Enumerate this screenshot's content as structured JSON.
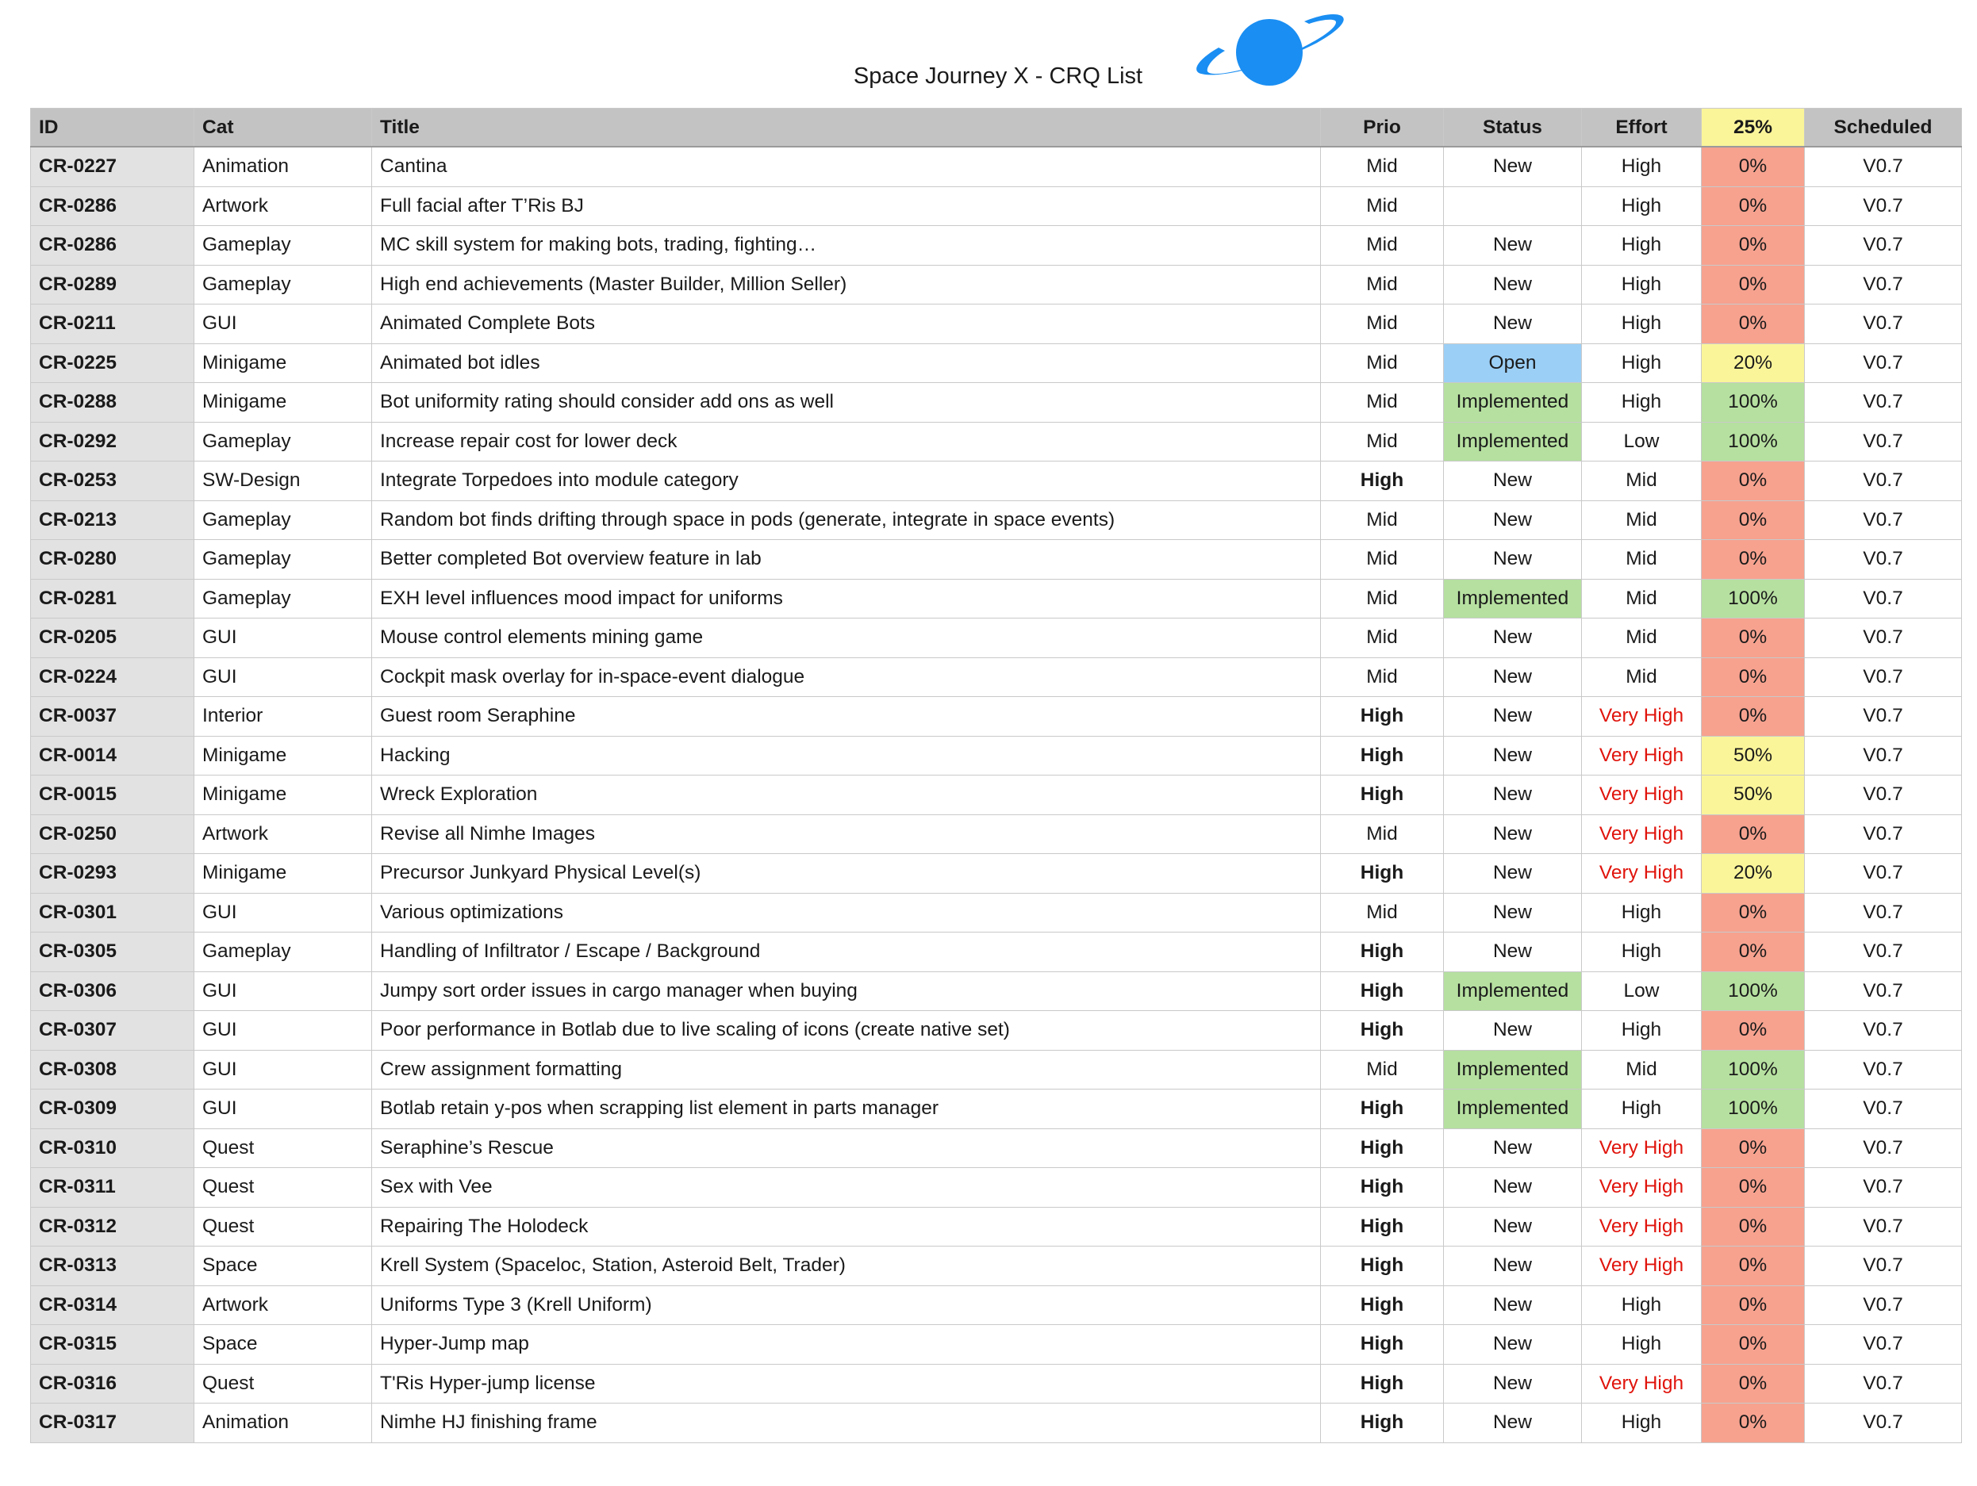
{
  "title": "Space Journey X - CRQ List",
  "logo_icon": "planet-icon",
  "colors": {
    "header_bg": "#c3c3c3",
    "id_col_bg": "#e2e2e2",
    "status_open": "#9ccff5",
    "status_implemented": "#b6e0a0",
    "pct_low": "#f6a28f",
    "pct_mid": "#fbf59a",
    "pct_done": "#b6e0a0",
    "very_high_text": "#e0140c",
    "planet": "#1a8ef2"
  },
  "columns": [
    "ID",
    "Cat",
    "Title",
    "Prio",
    "Status",
    "Effort",
    "25%",
    "Scheduled"
  ],
  "rows": [
    {
      "id": "CR-0227",
      "cat": "Animation",
      "title": "Cantina",
      "prio": "Mid",
      "status": "New",
      "effort": "High",
      "pct": "0%",
      "scheduled": "V0.7"
    },
    {
      "id": "CR-0286",
      "cat": "Artwork",
      "title": "Full facial after T’Ris BJ",
      "prio": "Mid",
      "status": "",
      "effort": "High",
      "pct": "0%",
      "scheduled": "V0.7"
    },
    {
      "id": "CR-0286",
      "cat": "Gameplay",
      "title": "MC skill system for making bots, trading, fighting…",
      "prio": "Mid",
      "status": "New",
      "effort": "High",
      "pct": "0%",
      "scheduled": "V0.7"
    },
    {
      "id": "CR-0289",
      "cat": "Gameplay",
      "title": "High end achievements (Master Builder, Million Seller)",
      "prio": "Mid",
      "status": "New",
      "effort": "High",
      "pct": "0%",
      "scheduled": "V0.7"
    },
    {
      "id": "CR-0211",
      "cat": "GUI",
      "title": "Animated Complete Bots",
      "prio": "Mid",
      "status": "New",
      "effort": "High",
      "pct": "0%",
      "scheduled": "V0.7"
    },
    {
      "id": "CR-0225",
      "cat": "Minigame",
      "title": "Animated bot idles",
      "prio": "Mid",
      "status": "Open",
      "effort": "High",
      "pct": "20%",
      "scheduled": "V0.7"
    },
    {
      "id": "CR-0288",
      "cat": "Minigame",
      "title": "Bot uniformity rating should consider add ons as well",
      "prio": "Mid",
      "status": "Implemented",
      "effort": "High",
      "pct": "100%",
      "scheduled": "V0.7"
    },
    {
      "id": "CR-0292",
      "cat": "Gameplay",
      "title": "Increase repair cost for lower deck",
      "prio": "Mid",
      "status": "Implemented",
      "effort": "Low",
      "pct": "100%",
      "scheduled": "V0.7"
    },
    {
      "id": "CR-0253",
      "cat": "SW-Design",
      "title": "Integrate Torpedoes into module category",
      "prio": "High",
      "status": "New",
      "effort": "Mid",
      "pct": "0%",
      "scheduled": "V0.7"
    },
    {
      "id": "CR-0213",
      "cat": "Gameplay",
      "title": "Random bot finds drifting through space in pods (generate, integrate in space events)",
      "prio": "Mid",
      "status": "New",
      "effort": "Mid",
      "pct": "0%",
      "scheduled": "V0.7"
    },
    {
      "id": "CR-0280",
      "cat": "Gameplay",
      "title": "Better completed Bot overview feature in lab",
      "prio": "Mid",
      "status": "New",
      "effort": "Mid",
      "pct": "0%",
      "scheduled": "V0.7"
    },
    {
      "id": "CR-0281",
      "cat": "Gameplay",
      "title": "EXH level influences mood impact for uniforms",
      "prio": "Mid",
      "status": "Implemented",
      "effort": "Mid",
      "pct": "100%",
      "scheduled": "V0.7"
    },
    {
      "id": "CR-0205",
      "cat": "GUI",
      "title": "Mouse control elements mining game",
      "prio": "Mid",
      "status": "New",
      "effort": "Mid",
      "pct": "0%",
      "scheduled": "V0.7"
    },
    {
      "id": "CR-0224",
      "cat": "GUI",
      "title": "Cockpit mask overlay for in-space-event dialogue",
      "prio": "Mid",
      "status": "New",
      "effort": "Mid",
      "pct": "0%",
      "scheduled": "V0.7"
    },
    {
      "id": "CR-0037",
      "cat": "Interior",
      "title": "Guest room Seraphine",
      "prio": "High",
      "status": "New",
      "effort": "Very High",
      "pct": "0%",
      "scheduled": "V0.7"
    },
    {
      "id": "CR-0014",
      "cat": "Minigame",
      "title": "Hacking",
      "prio": "High",
      "status": "New",
      "effort": "Very High",
      "pct": "50%",
      "scheduled": "V0.7"
    },
    {
      "id": "CR-0015",
      "cat": "Minigame",
      "title": "Wreck Exploration",
      "prio": "High",
      "status": "New",
      "effort": "Very High",
      "pct": "50%",
      "scheduled": "V0.7"
    },
    {
      "id": "CR-0250",
      "cat": "Artwork",
      "title": "Revise all Nimhe Images",
      "prio": "Mid",
      "status": "New",
      "effort": "Very High",
      "pct": "0%",
      "scheduled": "V0.7"
    },
    {
      "id": "CR-0293",
      "cat": "Minigame",
      "title": "Precursor Junkyard Physical Level(s)",
      "prio": "High",
      "status": "New",
      "effort": "Very High",
      "pct": "20%",
      "scheduled": "V0.7"
    },
    {
      "id": "CR-0301",
      "cat": "GUI",
      "title": "Various optimizations",
      "prio": "Mid",
      "status": "New",
      "effort": "High",
      "pct": "0%",
      "scheduled": "V0.7"
    },
    {
      "id": "CR-0305",
      "cat": "Gameplay",
      "title": "Handling of Infiltrator / Escape / Background",
      "prio": "High",
      "status": "New",
      "effort": "High",
      "pct": "0%",
      "scheduled": "V0.7"
    },
    {
      "id": "CR-0306",
      "cat": "GUI",
      "title": "Jumpy sort order issues in cargo manager when buying",
      "prio": "High",
      "status": "Implemented",
      "effort": "Low",
      "pct": "100%",
      "scheduled": "V0.7"
    },
    {
      "id": "CR-0307",
      "cat": "GUI",
      "title": "Poor performance in Botlab due to live scaling of icons (create native set)",
      "prio": "High",
      "status": "New",
      "effort": "High",
      "pct": "0%",
      "scheduled": "V0.7"
    },
    {
      "id": "CR-0308",
      "cat": "GUI",
      "title": "Crew assignment formatting",
      "prio": "Mid",
      "status": "Implemented",
      "effort": "Mid",
      "pct": "100%",
      "scheduled": "V0.7"
    },
    {
      "id": "CR-0309",
      "cat": "GUI",
      "title": "Botlab retain y-pos when scrapping list element in parts manager",
      "prio": "High",
      "status": "Implemented",
      "effort": "High",
      "pct": "100%",
      "scheduled": "V0.7"
    },
    {
      "id": "CR-0310",
      "cat": "Quest",
      "title": "Seraphine’s Rescue",
      "prio": "High",
      "status": "New",
      "effort": "Very High",
      "pct": "0%",
      "scheduled": "V0.7"
    },
    {
      "id": "CR-0311",
      "cat": "Quest",
      "title": "Sex with Vee",
      "prio": "High",
      "status": "New",
      "effort": "Very High",
      "pct": "0%",
      "scheduled": "V0.7"
    },
    {
      "id": "CR-0312",
      "cat": "Quest",
      "title": "Repairing The Holodeck",
      "prio": "High",
      "status": "New",
      "effort": "Very High",
      "pct": "0%",
      "scheduled": "V0.7"
    },
    {
      "id": "CR-0313",
      "cat": "Space",
      "title": "Krell System (Spaceloc, Station, Asteroid Belt, Trader)",
      "prio": "High",
      "status": "New",
      "effort": "Very High",
      "pct": "0%",
      "scheduled": "V0.7"
    },
    {
      "id": "CR-0314",
      "cat": "Artwork",
      "title": "Uniforms Type 3 (Krell Uniform)",
      "prio": "High",
      "status": "New",
      "effort": "High",
      "pct": "0%",
      "scheduled": "V0.7"
    },
    {
      "id": "CR-0315",
      "cat": "Space",
      "title": "Hyper-Jump map",
      "prio": "High",
      "status": "New",
      "effort": "High",
      "pct": "0%",
      "scheduled": "V0.7"
    },
    {
      "id": "CR-0316",
      "cat": "Quest",
      "title": "T'Ris Hyper-jump license",
      "prio": "High",
      "status": "New",
      "effort": "Very High",
      "pct": "0%",
      "scheduled": "V0.7"
    },
    {
      "id": "CR-0317",
      "cat": "Animation",
      "title": "Nimhe HJ finishing frame",
      "prio": "High",
      "status": "New",
      "effort": "High",
      "pct": "0%",
      "scheduled": "V0.7"
    }
  ]
}
